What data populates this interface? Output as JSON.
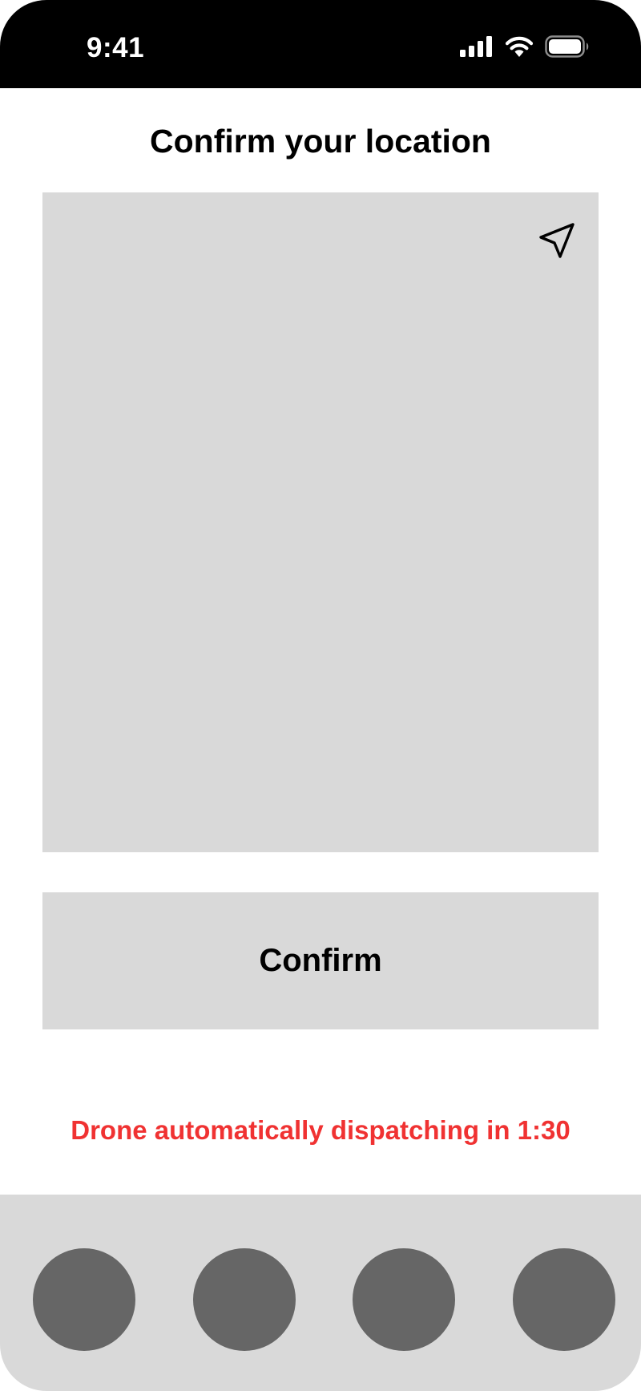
{
  "status_bar": {
    "time": "9:41",
    "icons": [
      "cellular-signal-icon",
      "wifi-icon",
      "battery-icon"
    ]
  },
  "page": {
    "title": "Confirm your location"
  },
  "map": {
    "locate_icon": "navigation-arrow-icon",
    "background_color": "#d9d9d9"
  },
  "confirm_button": {
    "label": "Confirm"
  },
  "dispatch_notice": {
    "text": "Drone automatically dispatching in 1:30",
    "color": "#f03232"
  },
  "tab_bar": {
    "tabs": [
      "tab-1",
      "tab-2",
      "tab-3",
      "tab-4"
    ],
    "tab_color": "#666666"
  }
}
